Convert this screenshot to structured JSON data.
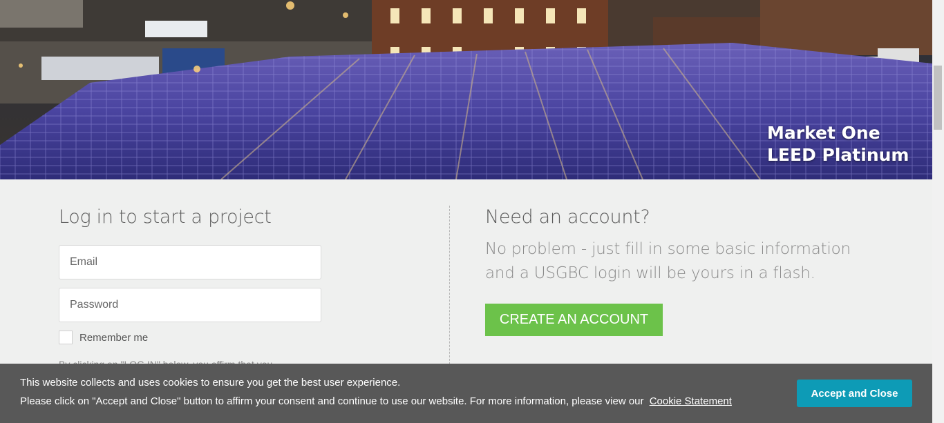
{
  "hero": {
    "caption_line1": "Market One",
    "caption_line2": "LEED Platinum",
    "colors": {
      "panel": "#3a3a8a",
      "sky": "#1b1a2c",
      "brick": "#6b3a25"
    }
  },
  "login": {
    "title": "Log in to start a project",
    "email_placeholder": "Email",
    "password_placeholder": "Password",
    "remember_label": "Remember me",
    "cut_text": "By clicking on \"LOG IN\" below, you affirm that you……"
  },
  "signup": {
    "title": "Need an account?",
    "description_line1": "No problem - just fill in some basic information",
    "description_line2": "and a USGBC login will be yours in a flash.",
    "create_button": "CREATE AN ACCOUNT",
    "button_color": "#6cc24a"
  },
  "cookie": {
    "line1": "This website collects and uses cookies to ensure you get the best user experience.",
    "line2": "Please click on \"Accept and Close\" button to affirm your consent and continue to use our website. For more information, please view our",
    "link": "Cookie Statement",
    "accept_button": "Accept and Close",
    "button_color": "#0d9bb6"
  }
}
